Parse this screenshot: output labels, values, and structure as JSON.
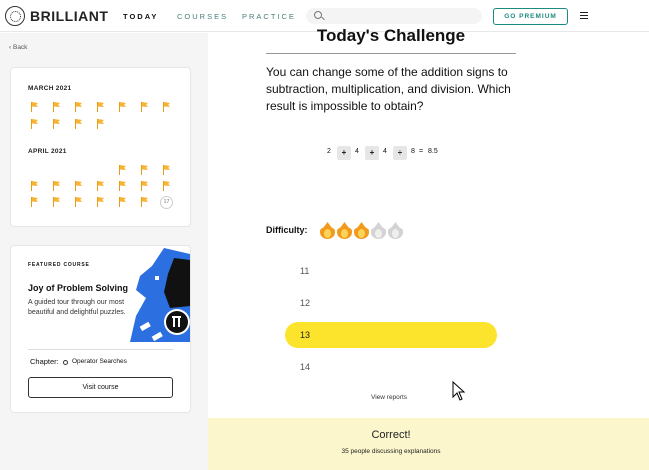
{
  "brand": {
    "name": "BRILLIANT"
  },
  "nav": {
    "today": "TODAY",
    "courses": "COURSES",
    "practice": "PRACTICE"
  },
  "search": {
    "placeholder": ""
  },
  "header": {
    "premium_label": "GO PREMIUM"
  },
  "sidebar": {
    "back_label": "Back",
    "calendar": {
      "months": [
        {
          "name": "MARCH 2021",
          "completed_days": 11
        },
        {
          "name": "APRIL 2021",
          "completed_days": 16,
          "current_day": "17"
        }
      ]
    },
    "featured": {
      "label": "FEATURED COURSE",
      "title": "Joy of Problem Solving",
      "description": "A guided tour through our most beautiful and delightful puzzles.",
      "chapter_label": "Chapter:",
      "chapter_value": "Operator Searches",
      "visit_label": "Visit course"
    }
  },
  "challenge": {
    "title": "Today's Challenge",
    "question": "You can change some of the addition signs to subtraction, multiplication, and division. Which result is impossible to obtain?",
    "expression": {
      "tokens": [
        "2",
        "+",
        "4",
        "+",
        "4",
        "÷",
        "8",
        "=",
        "8.5"
      ]
    },
    "difficulty_label": "Difficulty:",
    "difficulty_level": 3,
    "difficulty_max": 5,
    "options": [
      "11",
      "12",
      "13",
      "14"
    ],
    "selected_option": "13",
    "reports_label": "View reports"
  },
  "feedback": {
    "result": "Correct!",
    "discussion": "35 people discussing explanations"
  },
  "colors": {
    "accent": "#1b8a7f",
    "selected": "#fde42c",
    "banner": "#fbf6cc",
    "flame": "#f39a1c"
  }
}
